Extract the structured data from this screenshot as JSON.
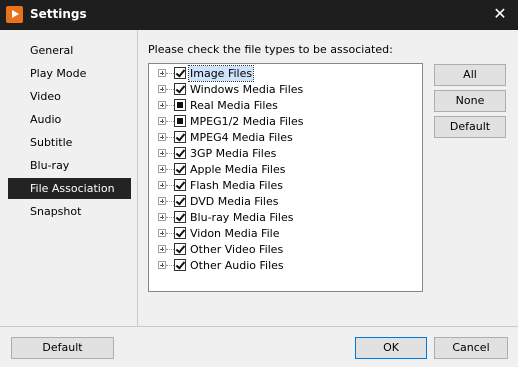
{
  "window": {
    "title": "Settings",
    "close_glyph": "✕",
    "app_icon": "play-logo-icon"
  },
  "sidebar": {
    "items": [
      {
        "label": "General",
        "active": false
      },
      {
        "label": "Play Mode",
        "active": false
      },
      {
        "label": "Video",
        "active": false
      },
      {
        "label": "Audio",
        "active": false
      },
      {
        "label": "Subtitle",
        "active": false
      },
      {
        "label": "Blu-ray",
        "active": false
      },
      {
        "label": "File Association",
        "active": true
      },
      {
        "label": "Snapshot",
        "active": false
      }
    ]
  },
  "main": {
    "prompt": "Please check the file types to be associated:",
    "file_types": [
      {
        "label": "Image Files",
        "state": "checked",
        "focused": true
      },
      {
        "label": "Windows Media Files",
        "state": "checked"
      },
      {
        "label": "Real Media Files",
        "state": "partial"
      },
      {
        "label": "MPEG1/2 Media Files",
        "state": "partial"
      },
      {
        "label": "MPEG4 Media Files",
        "state": "checked"
      },
      {
        "label": "3GP Media Files",
        "state": "checked"
      },
      {
        "label": "Apple Media Files",
        "state": "checked"
      },
      {
        "label": "Flash Media Files",
        "state": "checked"
      },
      {
        "label": "DVD Media Files",
        "state": "checked"
      },
      {
        "label": "Blu-ray Media Files",
        "state": "checked"
      },
      {
        "label": "Vidon Media File",
        "state": "checked"
      },
      {
        "label": "Other Video Files",
        "state": "checked"
      },
      {
        "label": "Other Audio Files",
        "state": "checked"
      }
    ],
    "buttons": {
      "all": "All",
      "none": "None",
      "default": "Default"
    }
  },
  "footer": {
    "default_label": "Default",
    "ok_label": "OK",
    "cancel_label": "Cancel"
  },
  "colors": {
    "titlebar_bg": "#1e1e1e",
    "accent": "#e8731a",
    "active_item_bg": "#232323",
    "focus_border": "#0078d7"
  }
}
